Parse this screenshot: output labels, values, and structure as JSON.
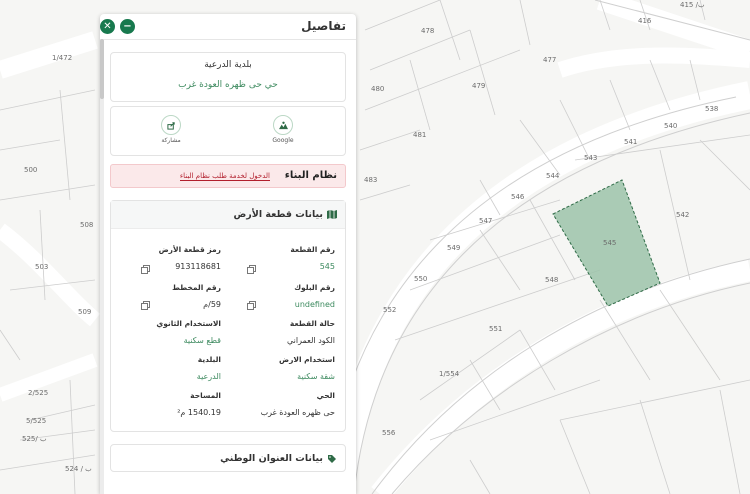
{
  "map": {
    "labels": [
      "416",
      "ب/ 415",
      "1/472",
      "478",
      "477",
      "480",
      "479",
      "481",
      "483",
      "538",
      "540",
      "541",
      "543",
      "544",
      "546",
      "545",
      "542",
      "547",
      "549",
      "550",
      "548",
      "552",
      "551",
      "1/554",
      "556",
      "508",
      "503",
      "509",
      "500",
      "5/525",
      "2/525",
      "525/ ب",
      "524 / ب"
    ]
  },
  "panel": {
    "title": "تفاصيل",
    "close_icon": "close-icon",
    "minimize_icon": "minimize-icon"
  },
  "municipality": {
    "name": "بلدية الدرعية",
    "district": "حي حى ظهره العودة غرب"
  },
  "actions": {
    "google_label": "Google",
    "share_label": "مشاركة"
  },
  "building": {
    "title": "نظام البناء",
    "link": "الدخول لخدمة طلب نظام البناء"
  },
  "land": {
    "title": "بيانات قطعة الأرض",
    "fields": {
      "parcel_number_label": "رقم القطعة",
      "parcel_number": "545",
      "parcel_code_label": "رمز قطعة الأرض",
      "parcel_code": "913118681",
      "block_number_label": "رقم البلوك",
      "block_number": "undefined",
      "plan_number_label": "رقم المخطط",
      "plan_number": "59/م",
      "parcel_status_label": "حالة القطعة",
      "parcel_status": "الكود العمراني",
      "secondary_use_label": "الاستخدام الثانوي",
      "secondary_use": "قطع سكنية",
      "land_use_label": "استخدام الارض",
      "land_use": "شقة سكنية",
      "municipality_label": "البلدية",
      "municipality": "الدرعية",
      "district_label": "الحي",
      "district": "حى ظهره العودة غرب",
      "area_label": "المساحة",
      "area": "1540.19 م²"
    }
  },
  "address": {
    "title": "بيانات العنوان الوطني"
  },
  "colors": {
    "accent": "#18794e",
    "selected_parcel": "#9cc3a9",
    "warning_bg": "#fbe9ea"
  }
}
